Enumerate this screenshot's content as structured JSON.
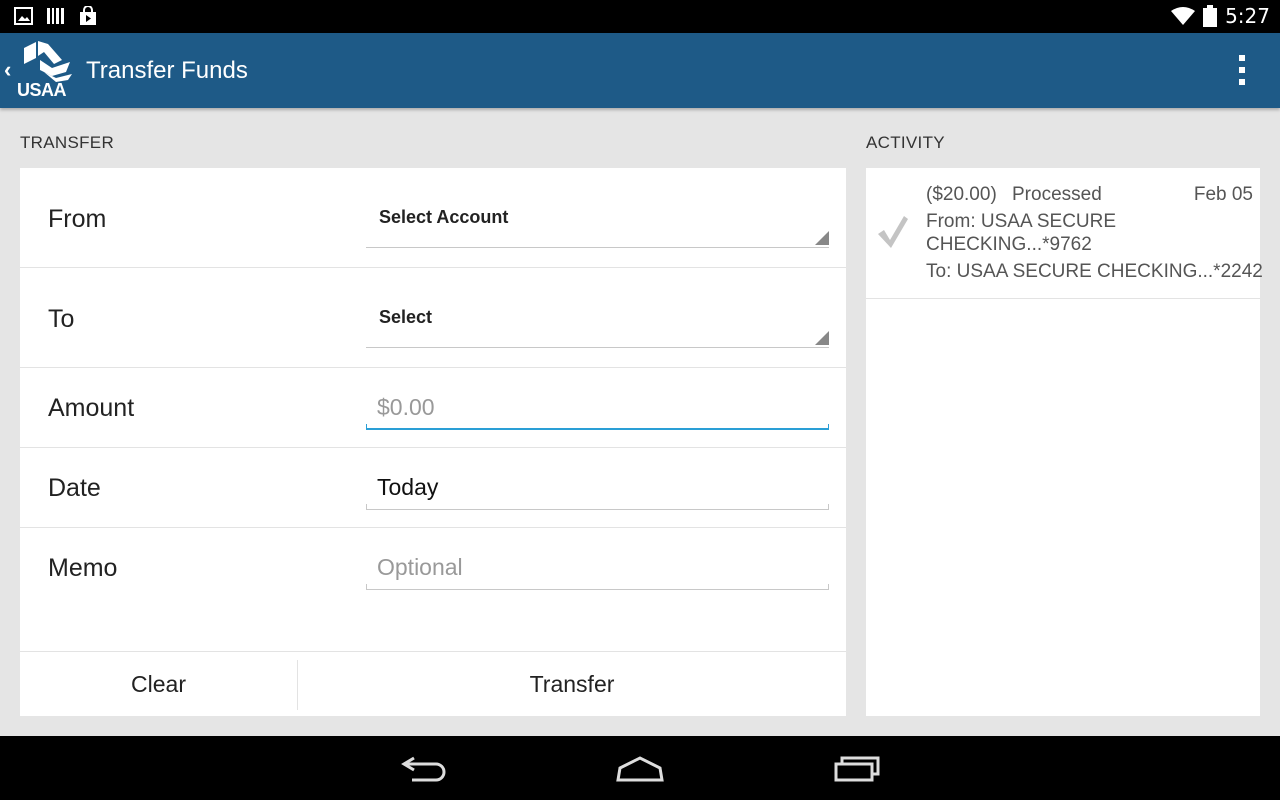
{
  "status_bar": {
    "time": "5:27",
    "left_icons": [
      "picture-icon",
      "barcode-icon",
      "shopping-bag-icon"
    ],
    "right_icons": [
      "wifi-icon",
      "battery-icon"
    ]
  },
  "action_bar": {
    "logo_text": "USAA",
    "title": "Transfer Funds",
    "color": "#1e5a87"
  },
  "transfer": {
    "section_title": "TRANSFER",
    "from": {
      "label": "From",
      "value": "Select Account"
    },
    "to": {
      "label": "To",
      "value": "Select"
    },
    "amount": {
      "label": "Amount",
      "placeholder": "$0.00"
    },
    "date": {
      "label": "Date",
      "value": "Today"
    },
    "memo": {
      "label": "Memo",
      "placeholder": "Optional"
    },
    "buttons": {
      "clear": "Clear",
      "transfer": "Transfer"
    }
  },
  "activity": {
    "section_title": "ACTIVITY",
    "items": [
      {
        "amount": "($20.00)",
        "status": "Processed",
        "date": "Feb 05",
        "from_line1": "From: USAA SECURE",
        "from_line2": "CHECKING...*9762",
        "to_line": "To: USAA SECURE CHECKING...*2242"
      }
    ]
  },
  "nav_bar": {
    "buttons": [
      "back-icon",
      "home-icon",
      "recent-apps-icon"
    ]
  }
}
